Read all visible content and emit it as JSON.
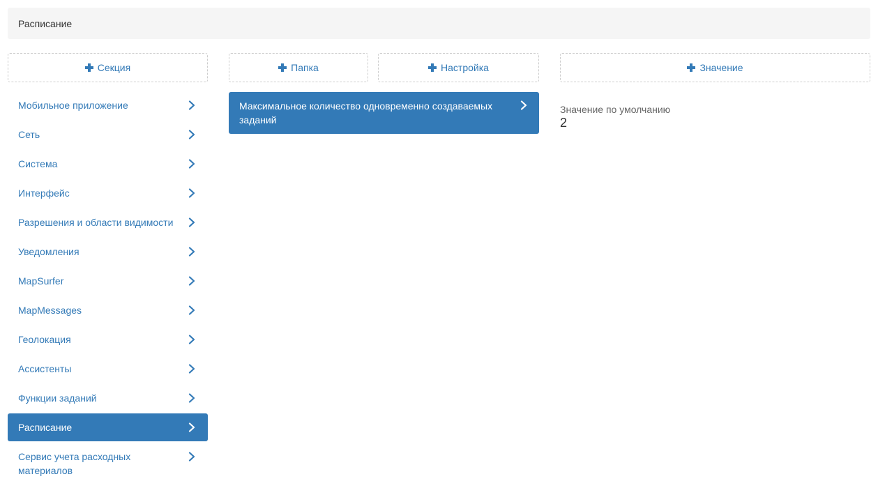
{
  "header": {
    "title": "Расписание"
  },
  "toolbar": {
    "add_section_label": "Секция",
    "add_folder_label": "Папка",
    "add_setting_label": "Настройка",
    "add_value_label": "Значение"
  },
  "sidebar": {
    "items": [
      {
        "label": "Мобильное приложение",
        "active": false
      },
      {
        "label": "Сеть",
        "active": false
      },
      {
        "label": "Система",
        "active": false
      },
      {
        "label": "Интерфейс",
        "active": false
      },
      {
        "label": "Разрешения и области видимости",
        "active": false
      },
      {
        "label": "Уведомления",
        "active": false
      },
      {
        "label": "MapSurfer",
        "active": false
      },
      {
        "label": "MapMessages",
        "active": false
      },
      {
        "label": "Геолокация",
        "active": false
      },
      {
        "label": "Ассистенты",
        "active": false
      },
      {
        "label": "Функции заданий",
        "active": false
      },
      {
        "label": "Расписание",
        "active": true
      },
      {
        "label": "Сервис учета расходных материалов",
        "active": false
      }
    ]
  },
  "settings": {
    "items": [
      {
        "label": "Максимальное количество одновременно создаваемых заданий",
        "active": true
      }
    ]
  },
  "value_panel": {
    "label": "Значение по умолчанию",
    "value": "2"
  },
  "icons": {
    "add": "plus-icon",
    "open": "chevron-right-icon"
  },
  "colors": {
    "accent": "#337ab7",
    "header_bg": "#f5f5f5",
    "border_dashed": "#cccccc"
  }
}
